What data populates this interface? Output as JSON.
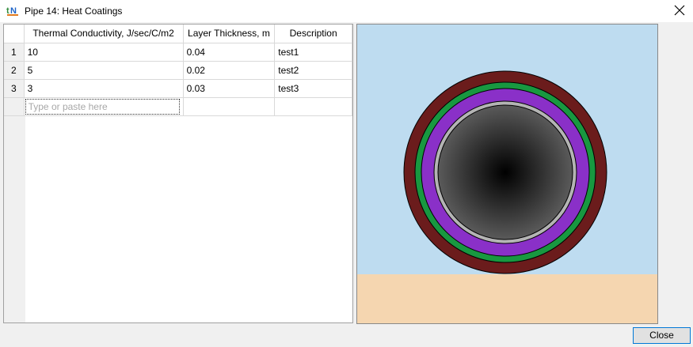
{
  "window": {
    "title": "Pipe 14: Heat Coatings",
    "app_icon": "tn-app-icon",
    "close_icon": "close-icon"
  },
  "grid": {
    "columns": [
      "Thermal Conductivity, J/sec/C/m2",
      "Layer Thickness, m",
      "Description"
    ],
    "rows": [
      {
        "num": "1",
        "conductivity": "10",
        "thickness": "0.04",
        "description": "test1"
      },
      {
        "num": "2",
        "conductivity": "5",
        "thickness": "0.02",
        "description": "test2"
      },
      {
        "num": "3",
        "conductivity": "3",
        "thickness": "0.03",
        "description": "test3"
      }
    ],
    "new_row_placeholder": "Type or paste here"
  },
  "preview": {
    "background_sky": "#bedcf0",
    "ground_color": "#f5d6b0",
    "layer_colors": [
      "#6b1c1c",
      "#189840",
      "#8a30c8",
      "#b4b4b4",
      "#2a2a2a"
    ]
  },
  "footer": {
    "close_label": "Close"
  }
}
